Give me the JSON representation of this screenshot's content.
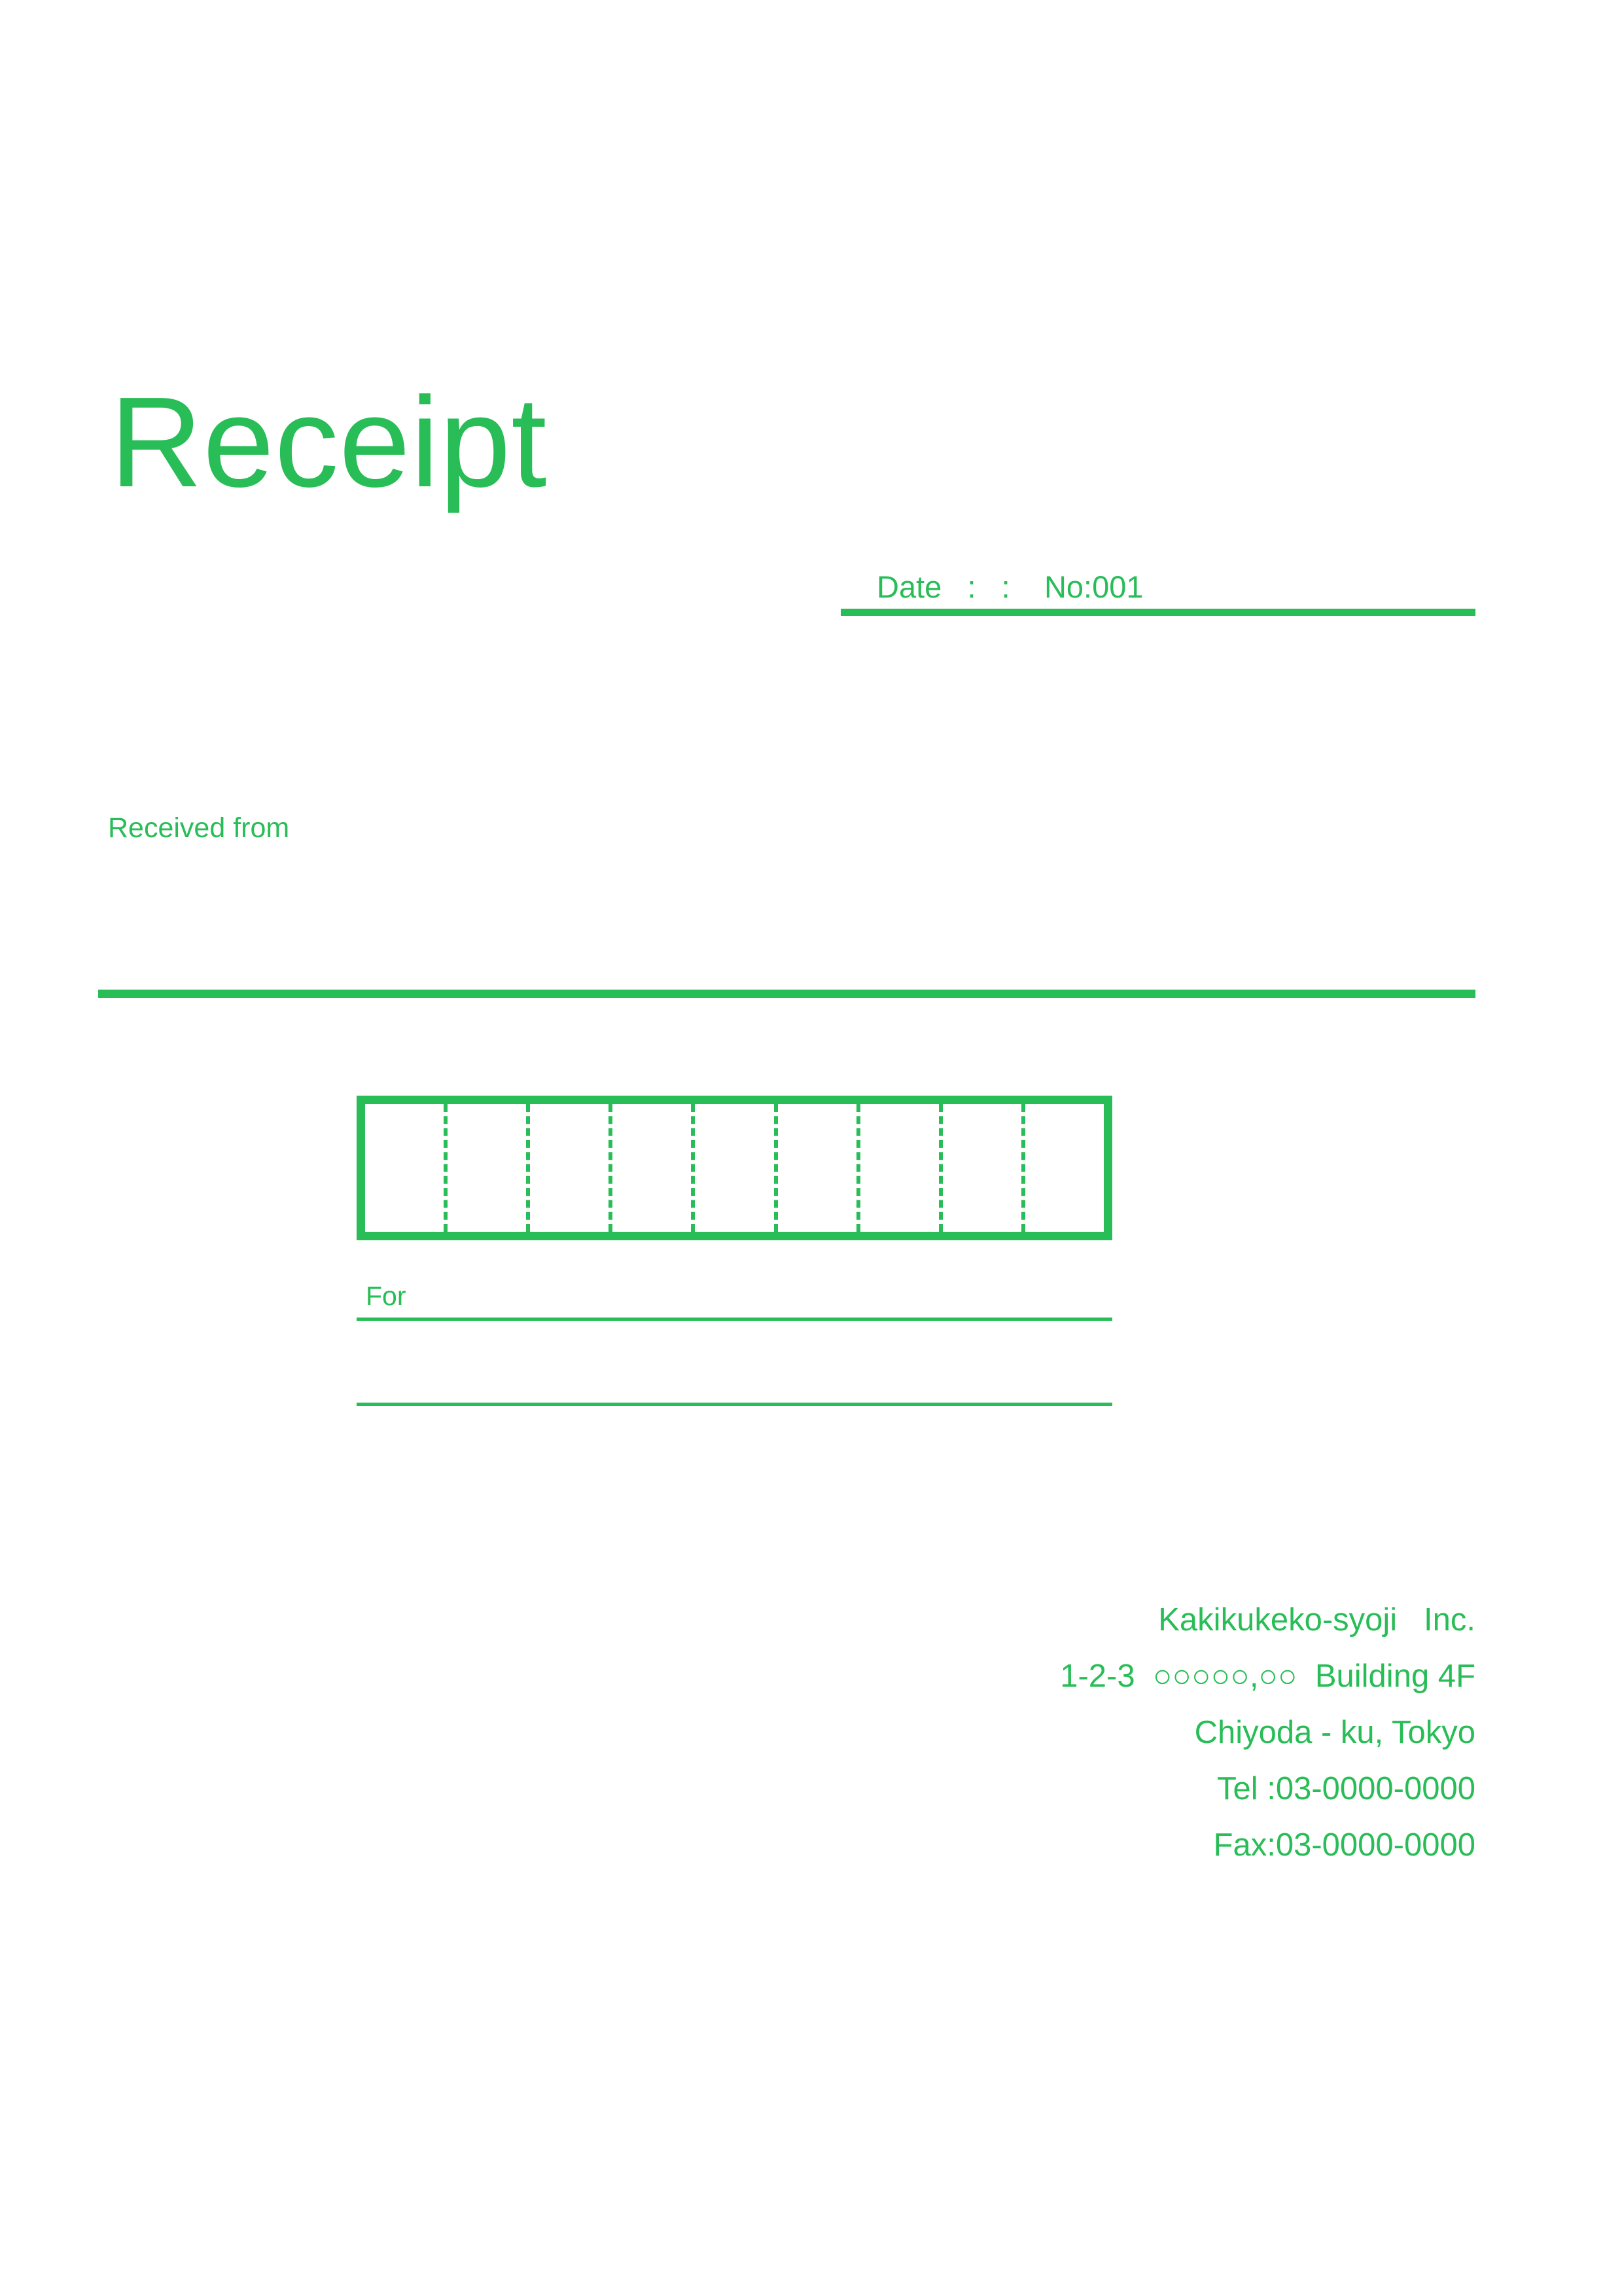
{
  "document": {
    "title": "Receipt",
    "theme_color": "#28bd56",
    "background_color": "#ffffff"
  },
  "header": {
    "title": "Receipt",
    "date_line": "Date   :   :    No:001",
    "date_label": "Date",
    "receipt_no": "No:001"
  },
  "payer": {
    "label": "Received from"
  },
  "amount": {
    "cell_count": 9,
    "value": ""
  },
  "purpose": {
    "label": "For",
    "value": "",
    "second_line_value": ""
  },
  "company": {
    "lines": [
      "Kakikukeko-syoji   Inc.",
      "1-2-3  ○○○○○,○○  Building 4F",
      "Chiyoda - ku, Tokyo",
      "Tel :03-0000-0000",
      "Fax:03-0000-0000"
    ],
    "name": "Kakikukeko-syoji   Inc.",
    "address_line_1": "1-2-3  ○○○○○,○○  Building 4F",
    "address_line_2": "Chiyoda - ku, Tokyo",
    "tel": "Tel :03-0000-0000",
    "fax": "Fax:03-0000-0000"
  }
}
